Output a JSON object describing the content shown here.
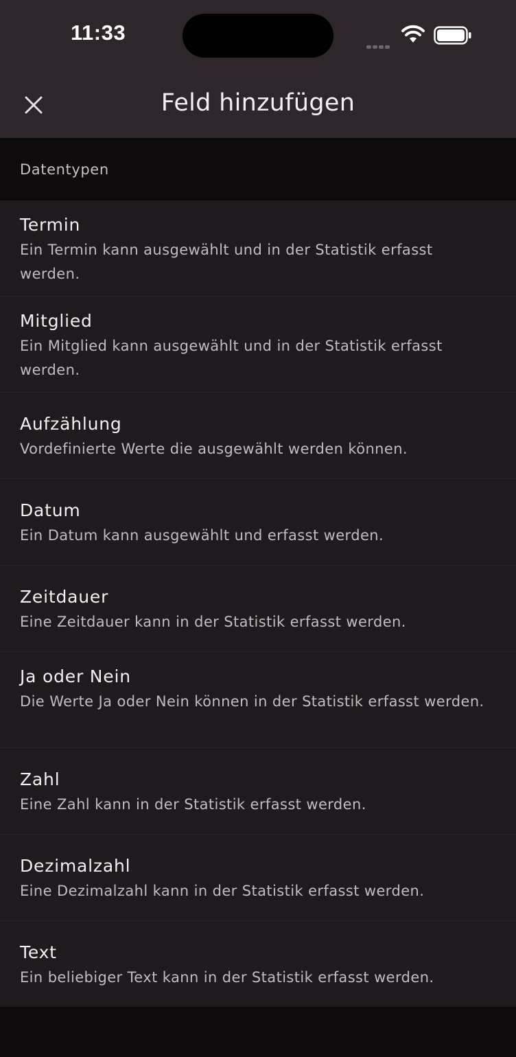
{
  "status_bar": {
    "time": "11:33"
  },
  "header": {
    "title": "Feld hinzufügen",
    "close_icon": "close-icon"
  },
  "section": {
    "label": "Datentypen"
  },
  "items": [
    {
      "title": "Termin",
      "description": "Ein Termin kann ausgewählt und in der Statistik erfasst werden."
    },
    {
      "title": "Mitglied",
      "description": "Ein Mitglied kann ausgewählt und in der Statistik erfasst werden."
    },
    {
      "title": "Aufzählung",
      "description": "Vordefinierte Werte die ausgewählt werden können."
    },
    {
      "title": "Datum",
      "description": "Ein Datum kann ausgewählt und erfasst werden."
    },
    {
      "title": "Zeitdauer",
      "description": "Eine Zeitdauer kann in der Statistik erfasst werden."
    },
    {
      "title": "Ja oder Nein",
      "description": "Die Werte Ja oder Nein können in der Statistik erfasst werden."
    },
    {
      "title": "Zahl",
      "description": "Eine Zahl kann in der Statistik erfasst werden."
    },
    {
      "title": "Dezimalzahl",
      "description": "Eine Dezimalzahl kann in der Statistik erfasst werden."
    },
    {
      "title": "Text",
      "description": "Ein beliebiger Text kann in der Statistik erfasst werden."
    }
  ],
  "colors": {
    "header_bg": "#2f262c",
    "list_bg": "#1f1a1d",
    "page_bg": "#0e0b0d",
    "title_text": "#f4eff3",
    "secondary_text": "#c3bbc1"
  }
}
